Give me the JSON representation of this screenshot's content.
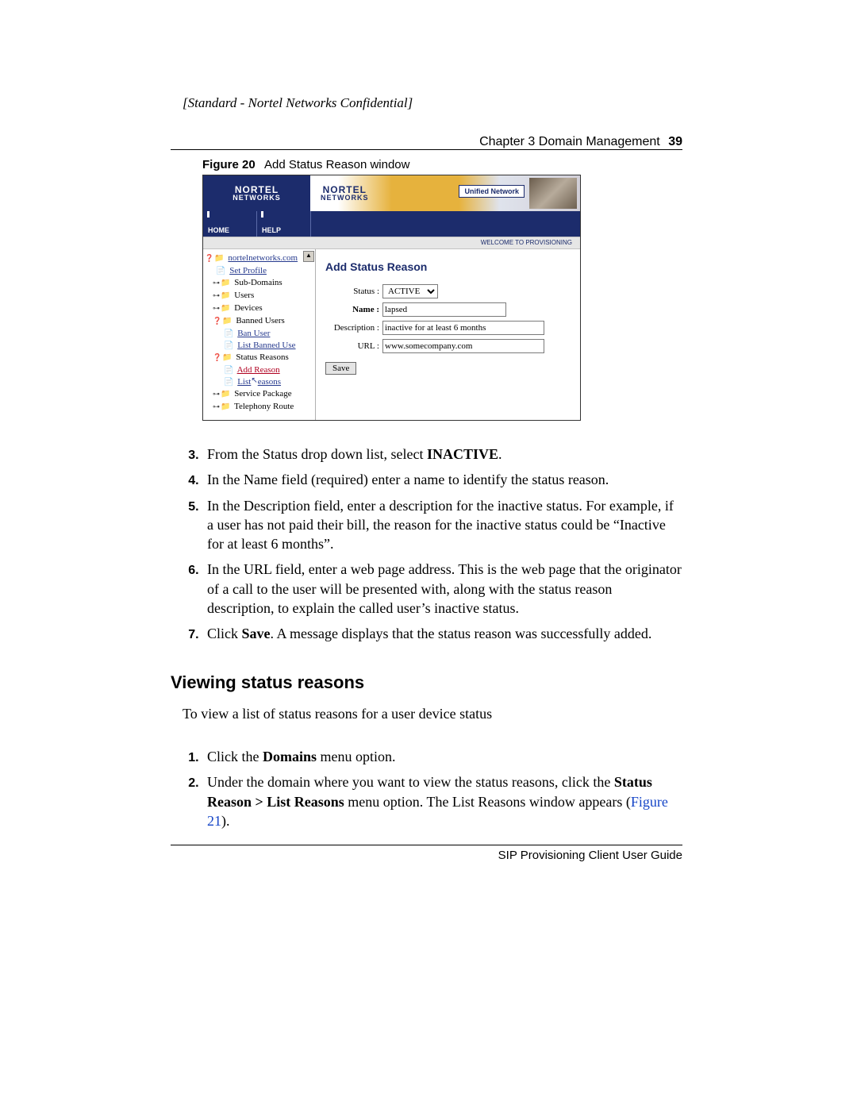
{
  "header": {
    "confidential": "[Standard - Nortel Networks Confidential]",
    "chapter": "Chapter 3  Domain Management",
    "page": "39"
  },
  "figure": {
    "label": "Figure 20",
    "caption": "Add Status Reason window"
  },
  "screenshot": {
    "logo_main": "NORTEL",
    "logo_sub": "NETWORKS",
    "unified": "Unified Network",
    "nav_home": "HOME",
    "nav_help": "HELP",
    "welcome": "WELCOME TO PROVISIONING",
    "tree": {
      "root": "nortelnetworks.com",
      "set_profile": "Set Profile",
      "sub_domains": "Sub-Domains",
      "users": "Users",
      "devices": "Devices",
      "banned_users": "Banned Users",
      "ban_user": "Ban User",
      "list_banned": "List Banned Use",
      "status_reasons": "Status Reasons",
      "add_reason": "Add Reason",
      "list_reasons_a": "List",
      "list_reasons_b": "easons",
      "service_package": "Service Package",
      "telephony_route": "Telephony Route"
    },
    "form": {
      "title": "Add Status Reason",
      "status_label": "Status :",
      "status_value": "ACTIVE",
      "name_label": "Name :",
      "name_value": "lapsed",
      "desc_label": "Description :",
      "desc_value": "inactive for at least 6 months",
      "url_label": "URL :",
      "url_value": "www.somecompany.com",
      "save": "Save"
    }
  },
  "steps_a": {
    "n3a": "From the Status drop down list, select ",
    "n3b": "INACTIVE",
    "n3c": ".",
    "n4": "In the Name field (required) enter a name to identify the status reason.",
    "n5": "In the Description field, enter a description for the inactive status. For example, if a user has not paid their bill, the reason for the inactive status could be “Inactive for at least 6 months”.",
    "n6": "In the URL field, enter a web page address. This is the web page that the originator of a call to the user will be presented with, along with the status reason description, to explain the called user’s inactive status.",
    "n7a": "Click ",
    "n7b": "Save",
    "n7c": ". A message displays that the status reason was successfully added."
  },
  "section_title": "Viewing status reasons",
  "para_intro": "To view a list of status reasons for a user device status",
  "steps_b": {
    "n1a": "Click the ",
    "n1b": "Domains",
    "n1c": " menu option.",
    "n2a": "Under the domain where you want to view the status reasons, click the ",
    "n2b": "Status Reason > List Reasons",
    "n2c": " menu option. The List Reasons window appears (",
    "n2d": "Figure 21",
    "n2e": ")."
  },
  "footer": "SIP Provisioning Client User Guide"
}
